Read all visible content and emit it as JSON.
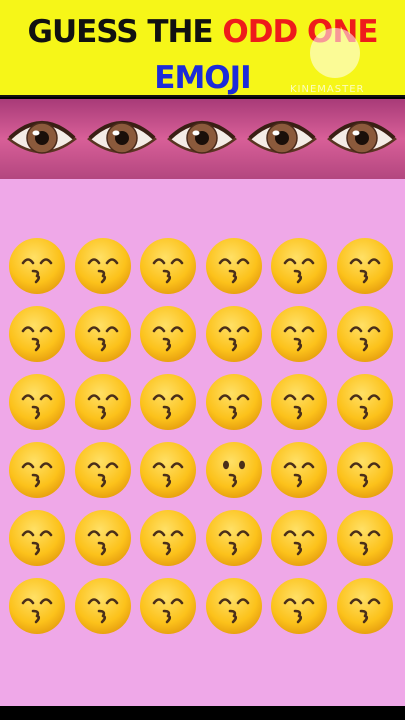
{
  "header": {
    "title_part1": "GUESS THE ",
    "title_part2": "ODD ONE",
    "title_line2": "EMOJI",
    "watermark": "KINEMASTER"
  },
  "colors": {
    "title_bg": "#f6f618",
    "title_black": "#111111",
    "title_red": "#ee1b1b",
    "title_blue": "#1d2cd8",
    "band": "#c8508a",
    "grid_bg": "#efa8e8",
    "face": "#fcc21b"
  },
  "eyes": [
    "eye-icon",
    "eye-icon",
    "eye-icon",
    "eye-icon",
    "eye-icon"
  ],
  "grid": {
    "rows": 6,
    "cols": 6,
    "emoji_name": "kissing-face-with-smiling-eyes-icon",
    "odd_emoji_name": "kissing-face-icon",
    "odd_row": 3,
    "odd_col": 3
  }
}
